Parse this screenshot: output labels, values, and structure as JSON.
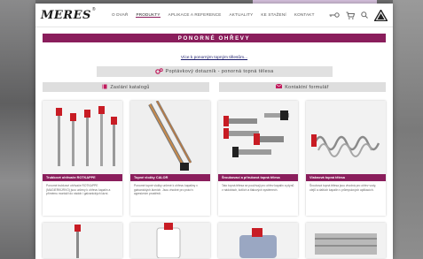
{
  "header": {
    "logo_text": "MERES",
    "logo_reg": "®",
    "nav": [
      {
        "label": "O DVAŘ"
      },
      {
        "label": "PRODUKTY"
      },
      {
        "label": "APLIKACE A REFERENCE"
      },
      {
        "label": "AKTUALITY"
      },
      {
        "label": "KE STAŽENÍ"
      },
      {
        "label": "KONTAKT"
      }
    ]
  },
  "main": {
    "title": "PONORNÉ OHŘEVY",
    "link": "Více k ponorným topným tělesům...",
    "form_label": "Poptávkový dotazník - ponorná topná tělesa",
    "cta_catalog": "Zaslání katalogů",
    "cta_contact": "Kontaktní formulář",
    "cards": [
      {
        "label": "Trubkové ohřívače ROTKAPPE",
        "desc": "Ponorné trubkové ohřívače ROTKAPPE (MAGIERKÜRVO) jsou určeny k ohřevu kapalin a přímému montáži do nádob i galvanických lázní."
      },
      {
        "label": "Topné vložky CALOR",
        "desc": "Ponorné topné vložky určené k ohřevu kapaliny v galvanických lázních. Jsou vhodné pro práci v agresivním prostředí."
      },
      {
        "label": "Šroubovací a přírubová topná tělesa",
        "desc": "Tato topná tělesa se používají pro ohřev kapalin a plynů v nádobách, kotlích a tlakových systémech."
      },
      {
        "label": "Vlaknová topná tělesa",
        "desc": "Šroubová topná tělesa jsou vhodná pro ohřev vody, olejů a dalších kapalin v průmyslových aplikacích."
      }
    ]
  }
}
